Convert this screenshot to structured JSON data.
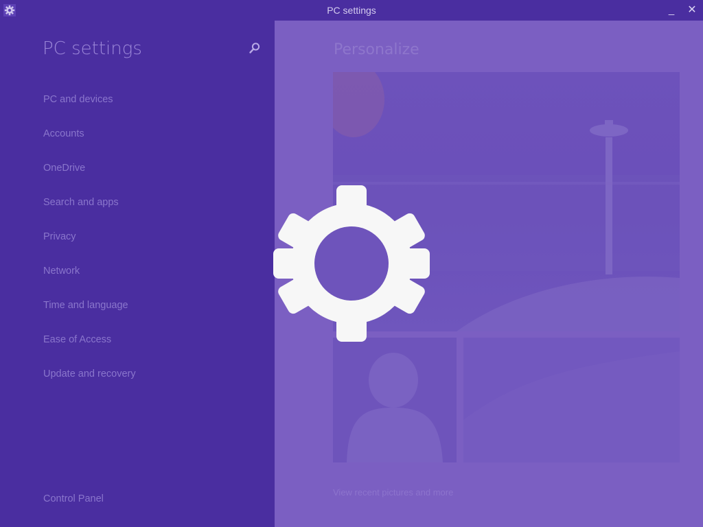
{
  "window": {
    "title": "PC settings",
    "minimize_glyph": "_",
    "close_glyph": "✕",
    "app_icon": "gear-icon"
  },
  "sidebar": {
    "title": "PC settings",
    "search_icon": "search-icon",
    "items": [
      {
        "label": "PC and devices"
      },
      {
        "label": "Accounts"
      },
      {
        "label": "OneDrive"
      },
      {
        "label": "Search and apps"
      },
      {
        "label": "Privacy"
      },
      {
        "label": "Network"
      },
      {
        "label": "Time and language"
      },
      {
        "label": "Ease of Access"
      },
      {
        "label": "Update and recovery"
      }
    ],
    "footer_link": "Control Panel"
  },
  "content": {
    "title": "Personalize",
    "link": "View recent pictures and more"
  },
  "colors": {
    "sidebar_bg": "#4a2ea0",
    "content_bg": "#7b5fc2",
    "gear": "#f7f7f7"
  }
}
